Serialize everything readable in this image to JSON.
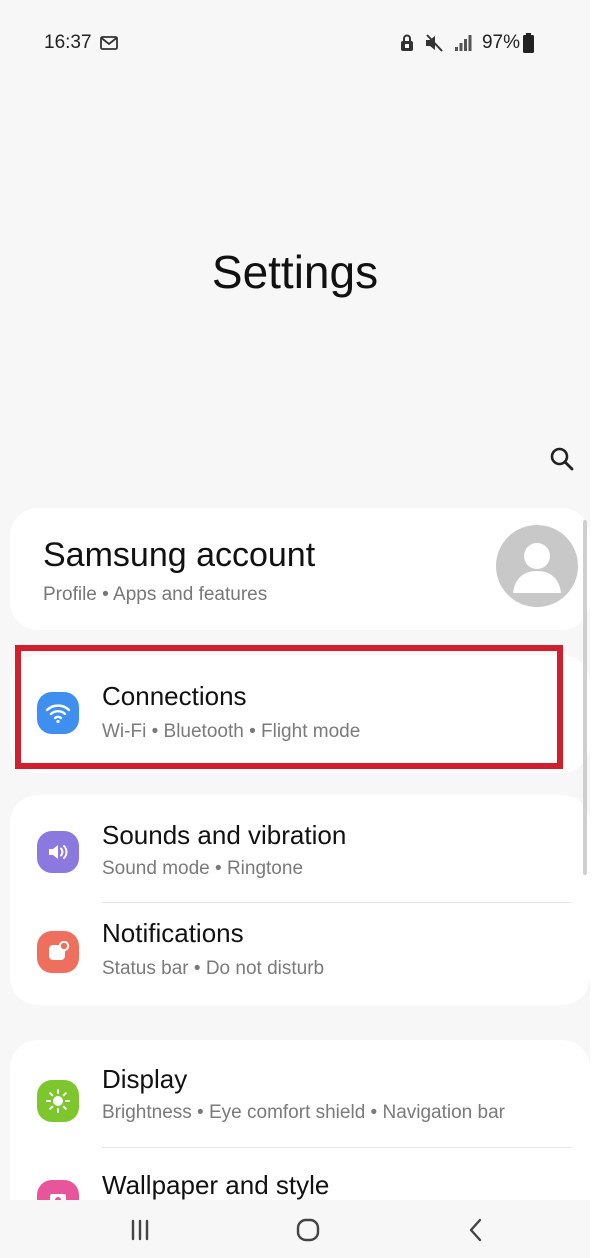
{
  "status_bar": {
    "time": "16:37",
    "battery": "97%",
    "icons": [
      "gmail-icon",
      "lock-icon",
      "mute-icon",
      "signal-icon",
      "battery-icon"
    ]
  },
  "header": {
    "title": "Settings",
    "search_icon": "search-icon"
  },
  "account": {
    "title": "Samsung account",
    "subtitle": "Profile  •  Apps and features",
    "avatar_icon": "avatar-icon"
  },
  "items": [
    {
      "title": "Connections",
      "subtitle": "Wi-Fi  •  Bluetooth  •  Flight mode",
      "icon": "wifi-icon",
      "color": "#3e8ff0"
    },
    {
      "title": "Sounds and vibration",
      "subtitle": "Sound mode  •  Ringtone",
      "icon": "volume-icon",
      "color": "#8b79e0"
    },
    {
      "title": "Notifications",
      "subtitle": "Status bar  •  Do not disturb",
      "icon": "notification-icon",
      "color": "#ef6f5e"
    },
    {
      "title": "Display",
      "subtitle": "Brightness  •  Eye comfort shield  •  Navigation bar",
      "icon": "brightness-icon",
      "color": "#7dc62d"
    },
    {
      "title": "Wallpaper and style",
      "subtitle": "",
      "icon": "wallpaper-icon",
      "color": "#e8559a"
    }
  ],
  "highlight_color": "#d0202f",
  "nav_bar": {
    "buttons": [
      "recent-apps-icon",
      "home-icon",
      "back-icon"
    ]
  }
}
